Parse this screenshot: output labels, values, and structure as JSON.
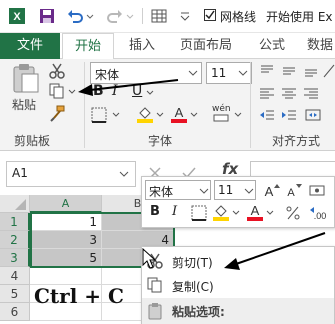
{
  "titlebar": {
    "gridlines_label": "网格线",
    "window_title": "开始使用 Ex"
  },
  "tabs": {
    "file": "文件",
    "home": "开始",
    "insert": "插入",
    "layout": "页面布局",
    "formulas": "公式",
    "data": "数据"
  },
  "ribbon": {
    "paste_label": "粘贴",
    "font_name": "宋体",
    "font_size": "11",
    "clipboard_group": "剪贴板",
    "font_group": "字体",
    "alignment_group": "对齐方式",
    "bold": "B",
    "italic": "I",
    "underline": "U",
    "phonetic": "wén",
    "font_color": "#e81123",
    "fill_color": "#ffd400"
  },
  "formula_bar": {
    "name_box": "A1",
    "fx": "fx"
  },
  "sheet": {
    "columns": [
      "A",
      "B"
    ],
    "rows": [
      "1",
      "2",
      "3",
      "4",
      "5",
      "6"
    ],
    "cells": {
      "a1": "1",
      "a2": "3",
      "a3": "5",
      "b2": "4"
    },
    "note": "Ctrl + C"
  },
  "mini_toolbar": {
    "font_name": "宋体",
    "font_size": "11",
    "bold": "B",
    "italic": "I",
    "font_color": "#e81123",
    "fill_color": "#ffd400"
  },
  "context_menu": {
    "cut": "剪切(T)",
    "copy": "复制(C)",
    "paste_options": "粘贴选项:"
  }
}
